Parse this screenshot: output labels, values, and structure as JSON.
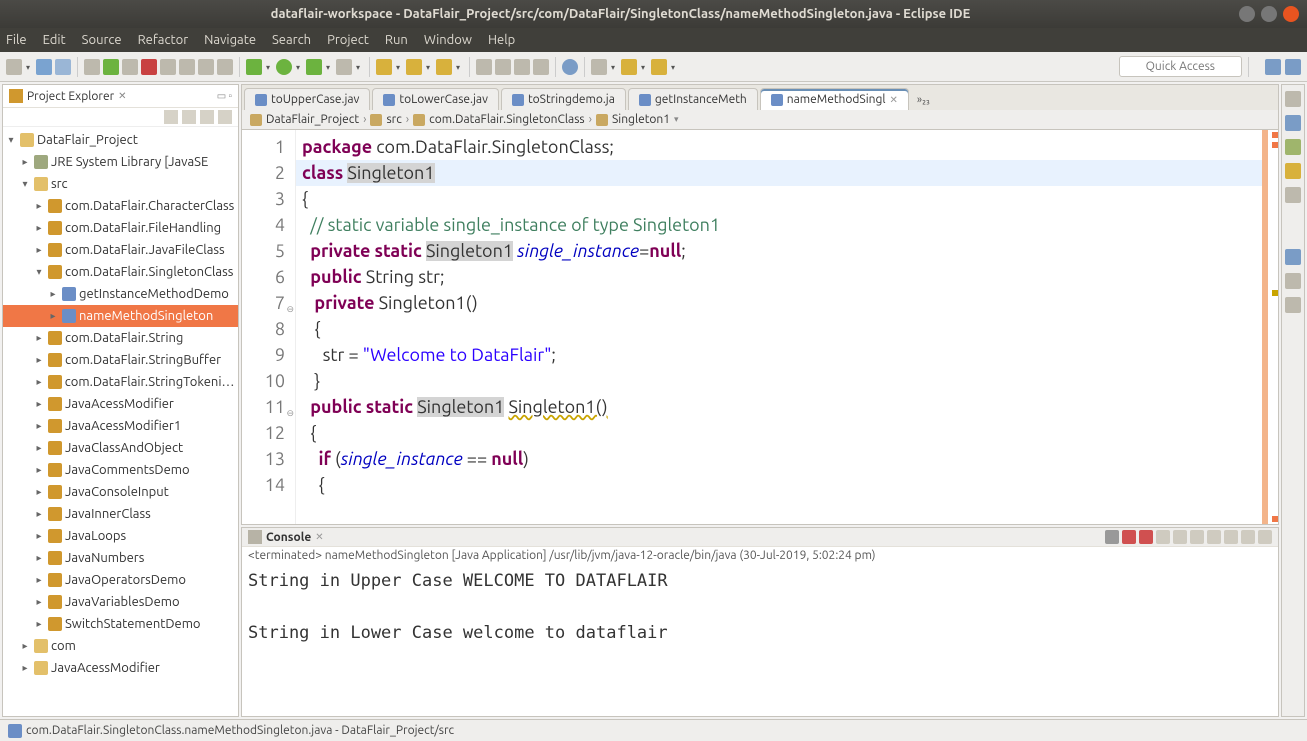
{
  "window": {
    "title": "dataflair-workspace - DataFlair_Project/src/com/DataFlair/SingletonClass/nameMethodSingleton.java - Eclipse IDE"
  },
  "menu": [
    "File",
    "Edit",
    "Source",
    "Refactor",
    "Navigate",
    "Search",
    "Project",
    "Run",
    "Window",
    "Help"
  ],
  "quick_access_placeholder": "Quick Access",
  "explorer": {
    "title": "Project Explorer",
    "items": [
      {
        "lvl": 0,
        "tw": "▾",
        "cls": "fld",
        "label": "DataFlair_Project"
      },
      {
        "lvl": 1,
        "tw": "▸",
        "cls": "jar",
        "label": "JRE System Library [JavaSE"
      },
      {
        "lvl": 1,
        "tw": "▾",
        "cls": "fld",
        "label": "src"
      },
      {
        "lvl": 2,
        "tw": "▸",
        "cls": "pkg",
        "label": "com.DataFlair.CharacterClass"
      },
      {
        "lvl": 2,
        "tw": "▸",
        "cls": "pkg",
        "label": "com.DataFlair.FileHandling"
      },
      {
        "lvl": 2,
        "tw": "▸",
        "cls": "pkg",
        "label": "com.DataFlair.JavaFileClass"
      },
      {
        "lvl": 2,
        "tw": "▾",
        "cls": "pkg",
        "label": "com.DataFlair.SingletonClass"
      },
      {
        "lvl": 3,
        "tw": "▸",
        "cls": "cls",
        "label": "getInstanceMethodDemo"
      },
      {
        "lvl": 3,
        "tw": "▸",
        "cls": "cls",
        "label": "nameMethodSingleton",
        "selected": true
      },
      {
        "lvl": 2,
        "tw": "▸",
        "cls": "pkg",
        "label": "com.DataFlair.String"
      },
      {
        "lvl": 2,
        "tw": "▸",
        "cls": "pkg",
        "label": "com.DataFlair.StringBuffer"
      },
      {
        "lvl": 2,
        "tw": "▸",
        "cls": "pkg",
        "label": "com.DataFlair.StringTokenizer"
      },
      {
        "lvl": 2,
        "tw": "▸",
        "cls": "pkg",
        "label": "JavaAcessModifier"
      },
      {
        "lvl": 2,
        "tw": "▸",
        "cls": "pkg",
        "label": "JavaAcessModifier1"
      },
      {
        "lvl": 2,
        "tw": "▸",
        "cls": "pkg",
        "label": "JavaClassAndObject"
      },
      {
        "lvl": 2,
        "tw": "▸",
        "cls": "pkg",
        "label": "JavaCommentsDemo"
      },
      {
        "lvl": 2,
        "tw": "▸",
        "cls": "pkg",
        "label": "JavaConsoleInput"
      },
      {
        "lvl": 2,
        "tw": "▸",
        "cls": "pkg",
        "label": "JavaInnerClass"
      },
      {
        "lvl": 2,
        "tw": "▸",
        "cls": "pkg",
        "label": "JavaLoops"
      },
      {
        "lvl": 2,
        "tw": "▸",
        "cls": "pkg",
        "label": "JavaNumbers"
      },
      {
        "lvl": 2,
        "tw": "▸",
        "cls": "pkg",
        "label": "JavaOperatorsDemo"
      },
      {
        "lvl": 2,
        "tw": "▸",
        "cls": "pkg",
        "label": "JavaVariablesDemo"
      },
      {
        "lvl": 2,
        "tw": "▸",
        "cls": "pkg",
        "label": "SwitchStatementDemo"
      },
      {
        "lvl": 1,
        "tw": "▸",
        "cls": "fld",
        "label": "com"
      },
      {
        "lvl": 1,
        "tw": "▸",
        "cls": "fld",
        "label": "JavaAcessModifier"
      }
    ]
  },
  "tabs": [
    {
      "label": "toUpperCase.jav"
    },
    {
      "label": "toLowerCase.jav"
    },
    {
      "label": "toStringdemo.ja"
    },
    {
      "label": "getInstanceMeth"
    },
    {
      "label": "nameMethodSingl",
      "active": true
    }
  ],
  "tabs_more": "»₂₃",
  "breadcrumb": [
    "DataFlair_Project",
    "src",
    "com.DataFlair.SingletonClass",
    "Singleton1"
  ],
  "code": {
    "lines": [
      {
        "n": 1,
        "segs": [
          {
            "t": "package",
            "c": "kw"
          },
          {
            "t": " com.DataFlair.SingletonClass;"
          }
        ]
      },
      {
        "n": 2,
        "hl": true,
        "segs": [
          {
            "t": "class",
            "c": "kw"
          },
          {
            "t": " "
          },
          {
            "t": "Singleton1",
            "c": "typ-hl"
          }
        ]
      },
      {
        "n": 3,
        "segs": [
          {
            "t": "{"
          }
        ]
      },
      {
        "n": 4,
        "segs": [
          {
            "t": "  "
          },
          {
            "t": "// static variable single_instance of type Singleton1",
            "c": "cm"
          }
        ]
      },
      {
        "n": 5,
        "segs": [
          {
            "t": "  "
          },
          {
            "t": "private",
            "c": "kw"
          },
          {
            "t": " "
          },
          {
            "t": "static",
            "c": "kw"
          },
          {
            "t": " "
          },
          {
            "t": "Singleton1",
            "c": "typ-hl"
          },
          {
            "t": " "
          },
          {
            "t": "single_instance",
            "c": "fld-i"
          },
          {
            "t": "="
          },
          {
            "t": "null",
            "c": "kw"
          },
          {
            "t": ";"
          }
        ]
      },
      {
        "n": 6,
        "segs": [
          {
            "t": "  "
          },
          {
            "t": "public",
            "c": "kw"
          },
          {
            "t": " String str;"
          }
        ]
      },
      {
        "n": 7,
        "fold": true,
        "segs": [
          {
            "t": "   "
          },
          {
            "t": "private",
            "c": "kw"
          },
          {
            "t": " Singleton1()"
          }
        ]
      },
      {
        "n": 8,
        "segs": [
          {
            "t": "   {"
          }
        ]
      },
      {
        "n": 9,
        "segs": [
          {
            "t": "     str = "
          },
          {
            "t": "\"Welcome to DataFlair\"",
            "c": "str"
          },
          {
            "t": ";"
          }
        ]
      },
      {
        "n": 10,
        "segs": [
          {
            "t": "   }"
          }
        ]
      },
      {
        "n": 11,
        "fold": true,
        "warn": true,
        "segs": [
          {
            "t": "  "
          },
          {
            "t": "public",
            "c": "kw"
          },
          {
            "t": " "
          },
          {
            "t": "static",
            "c": "kw"
          },
          {
            "t": " "
          },
          {
            "t": "Singleton1",
            "c": "typ-hl"
          },
          {
            "t": " "
          },
          {
            "t": "Singleton1()",
            "c": "warn-u"
          }
        ]
      },
      {
        "n": 12,
        "segs": [
          {
            "t": "  {"
          }
        ]
      },
      {
        "n": 13,
        "segs": [
          {
            "t": "    "
          },
          {
            "t": "if",
            "c": "kw"
          },
          {
            "t": " ("
          },
          {
            "t": "single_instance",
            "c": "fld-i"
          },
          {
            "t": " == "
          },
          {
            "t": "null",
            "c": "kw"
          },
          {
            "t": ")"
          }
        ]
      },
      {
        "n": 14,
        "segs": [
          {
            "t": "    {"
          }
        ]
      }
    ]
  },
  "console": {
    "title": "Console",
    "meta": "<terminated> nameMethodSingleton [Java Application] /usr/lib/jvm/java-12-oracle/bin/java (30-Jul-2019, 5:02:24 pm)",
    "output": "String in Upper Case WELCOME TO DATAFLAIR\n\nString in Lower Case welcome to dataflair\n"
  },
  "statusbar": "com.DataFlair.SingletonClass.nameMethodSingleton.java - DataFlair_Project/src"
}
